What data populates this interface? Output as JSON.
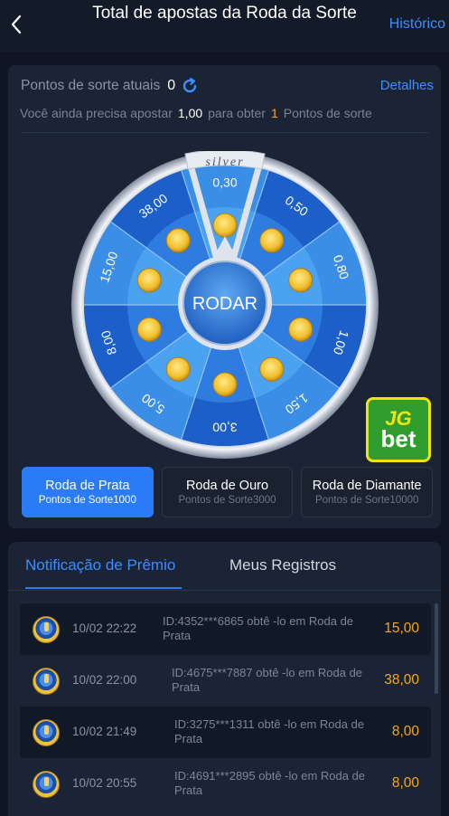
{
  "header": {
    "title": "Total de apostas da Roda da Sorte",
    "history_label": "Histórico"
  },
  "luck": {
    "current_label": "Pontos de sorte atuais",
    "current_value": "0",
    "details_label": "Detalhes",
    "need_prefix": "Você ainda precisa apostar",
    "need_amount": "1,00",
    "need_middle": "para obter",
    "need_points": "1",
    "need_suffix": "Pontos de sorte"
  },
  "wheel": {
    "banner": "silver",
    "spin_label": "RODAR",
    "segments": [
      "0,30",
      "0,50",
      "0,80",
      "1,00",
      "1,50",
      "3,00",
      "5,00",
      "8,00",
      "15,00",
      "38,00"
    ]
  },
  "brand": {
    "logo_top": "JG",
    "logo_bottom": "bet"
  },
  "tiers": [
    {
      "name": "Roda de Prata",
      "points": "Pontos de Sorte1000",
      "active": true
    },
    {
      "name": "Roda de Ouro",
      "points": "Pontos de Sorte3000",
      "active": false
    },
    {
      "name": "Roda de Diamante",
      "points": "Pontos de Sorte10000",
      "active": false
    }
  ],
  "records": {
    "tab_active": "Notificação de Prêmio",
    "tab_other": "Meus Registros",
    "rows": [
      {
        "date": "10/02 22:22",
        "text": "ID:4352***6865 obtê -lo em Roda de Prata",
        "amount": "15,00"
      },
      {
        "date": "10/02 22:00",
        "text": "ID:4675***7887 obtê -lo em Roda de Prata",
        "amount": "38,00"
      },
      {
        "date": "10/02 21:49",
        "text": "ID:3275***1311 obtê -lo em Roda de Prata",
        "amount": "8,00"
      },
      {
        "date": "10/02 20:55",
        "text": "ID:4691***2895 obtê -lo em Roda de Prata",
        "amount": "8,00"
      }
    ]
  },
  "colors": {
    "accent": "#2a7bf5",
    "amount": "#f5a623",
    "wheel_dark": "#1d5fc9",
    "wheel_light": "#3b8ee6"
  }
}
